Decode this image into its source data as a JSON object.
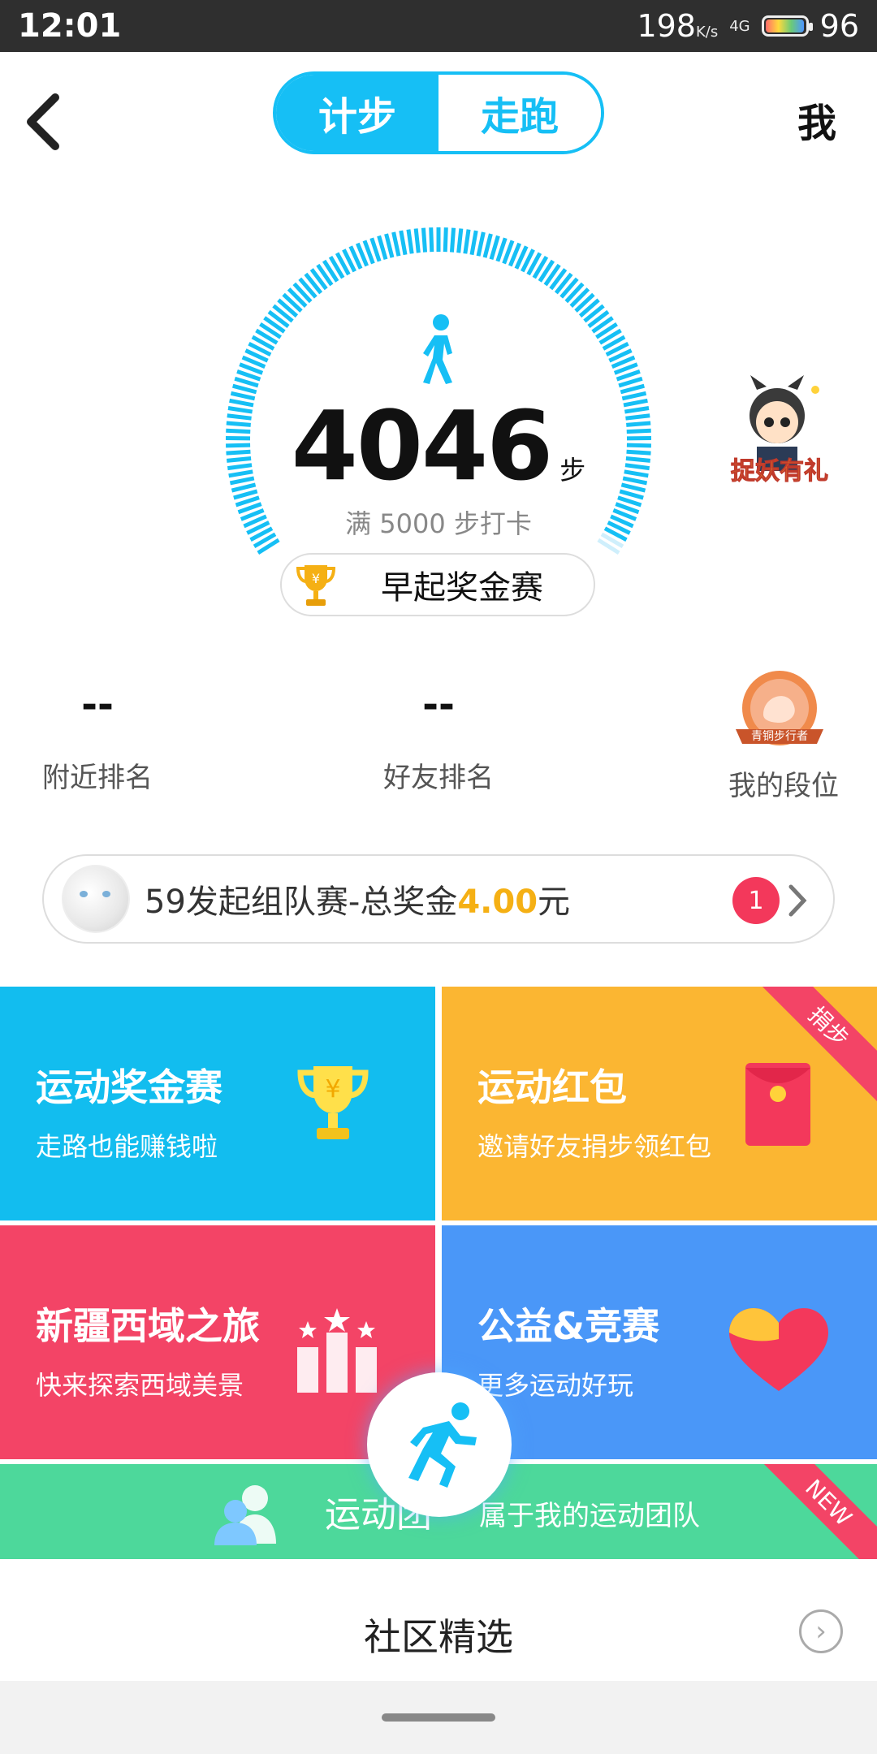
{
  "status_bar": {
    "time": "12:01",
    "speed_value": "198",
    "speed_unit": "K/s",
    "network": "4G",
    "battery": "96"
  },
  "header": {
    "tabs": [
      {
        "label": "计步",
        "active": true
      },
      {
        "label": "走跑",
        "active": false
      }
    ],
    "me_label": "我"
  },
  "dial": {
    "steps": "4046",
    "steps_unit": "步",
    "goal_text": "满 5000 步打卡",
    "race_button": "早起奖金赛"
  },
  "mascot": {
    "label": "捉妖有礼"
  },
  "stats": {
    "nearby": {
      "value": "--",
      "label": "附近排名"
    },
    "friends": {
      "value": "--",
      "label": "好友排名"
    },
    "rank": {
      "label": "我的段位",
      "badge_text": "青铜步行者"
    }
  },
  "team_banner": {
    "prefix": "59发起组队赛-总奖金",
    "amount": "4.00",
    "suffix": "元",
    "badge": "1"
  },
  "tiles": [
    {
      "title": "运动奖金赛",
      "subtitle": "走路也能赚钱啦"
    },
    {
      "title": "运动红包",
      "subtitle": "邀请好友捐步领红包",
      "ribbon": "捐步"
    },
    {
      "title": "新疆西域之旅",
      "subtitle": "快来探索西域美景"
    },
    {
      "title": "公益&竞赛",
      "subtitle": "更多运动好玩"
    }
  ],
  "team_band": {
    "title": "运动团",
    "subtitle": "属于我的运动团队",
    "ribbon": "NEW"
  },
  "community": {
    "label": "社区精选"
  },
  "colors": {
    "accent": "#16bff5",
    "tile_blue": "#12bdef",
    "tile_orange": "#fbb632",
    "tile_red": "#f34466",
    "tile_indigo": "#4a97f8",
    "band_green": "#4dd89b",
    "gold": "#f5b014"
  }
}
